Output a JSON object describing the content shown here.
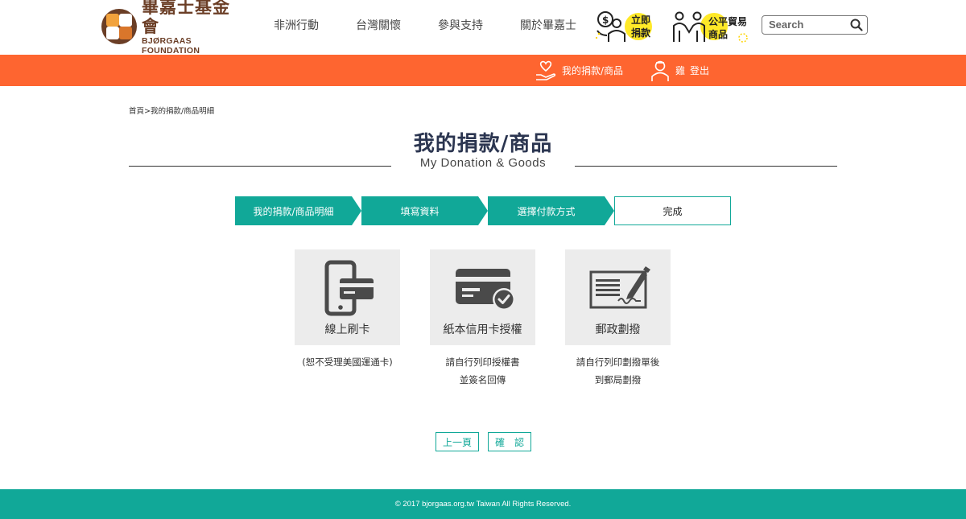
{
  "brand": {
    "name_zh": "畢嘉士基金會",
    "name_en": "BJØRGAAS FOUNDATION",
    "primary_color": "#fe6530",
    "accent_color": "#11a898",
    "brown_color": "#6b3e26"
  },
  "nav": {
    "items": [
      {
        "label": "非洲行動"
      },
      {
        "label": "台灣關懷"
      },
      {
        "label": "參與支持"
      },
      {
        "label": "關於畢嘉士"
      }
    ]
  },
  "header_actions": {
    "donate_line1": "立即",
    "donate_line2": "捐款",
    "fairtrade_line1": "公平貿易",
    "fairtrade_line2": "商品"
  },
  "search": {
    "placeholder": "Search",
    "icon": "search-icon"
  },
  "member_bar": {
    "my_donation": "我的捐款/商品",
    "user_name": "雞",
    "logout": "登出"
  },
  "breadcrumb": {
    "home": "首頁",
    "separator": ">",
    "current": "我的捐款/商品明細"
  },
  "page": {
    "title_zh": "我的捐款/商品",
    "title_en": "My Donation & Goods"
  },
  "steps": [
    {
      "label": "我的捐款/商品明細"
    },
    {
      "label": "填寫資料"
    },
    {
      "label": "選擇付款方式"
    },
    {
      "label": "完成"
    }
  ],
  "payment_options": [
    {
      "label": "線上刷卡",
      "note_line1": "(恕不受理美國運通卡)",
      "note_line2": "",
      "icon": "mobile-card-icon"
    },
    {
      "label": "紙本信用卡授權",
      "note_line1": "請自行列印授權書",
      "note_line2": "並簽名回傳",
      "icon": "credit-card-check-icon"
    },
    {
      "label": "郵政劃撥",
      "note_line1": "請自行列印劃撥單後",
      "note_line2": "到郵局劃撥",
      "icon": "check-signing-icon"
    }
  ],
  "buttons": {
    "prev": "上一頁",
    "confirm": "確　認"
  },
  "footer": {
    "copyright": "© 2017 bjorgaas.org.tw Taiwan All Rights Reserved."
  }
}
